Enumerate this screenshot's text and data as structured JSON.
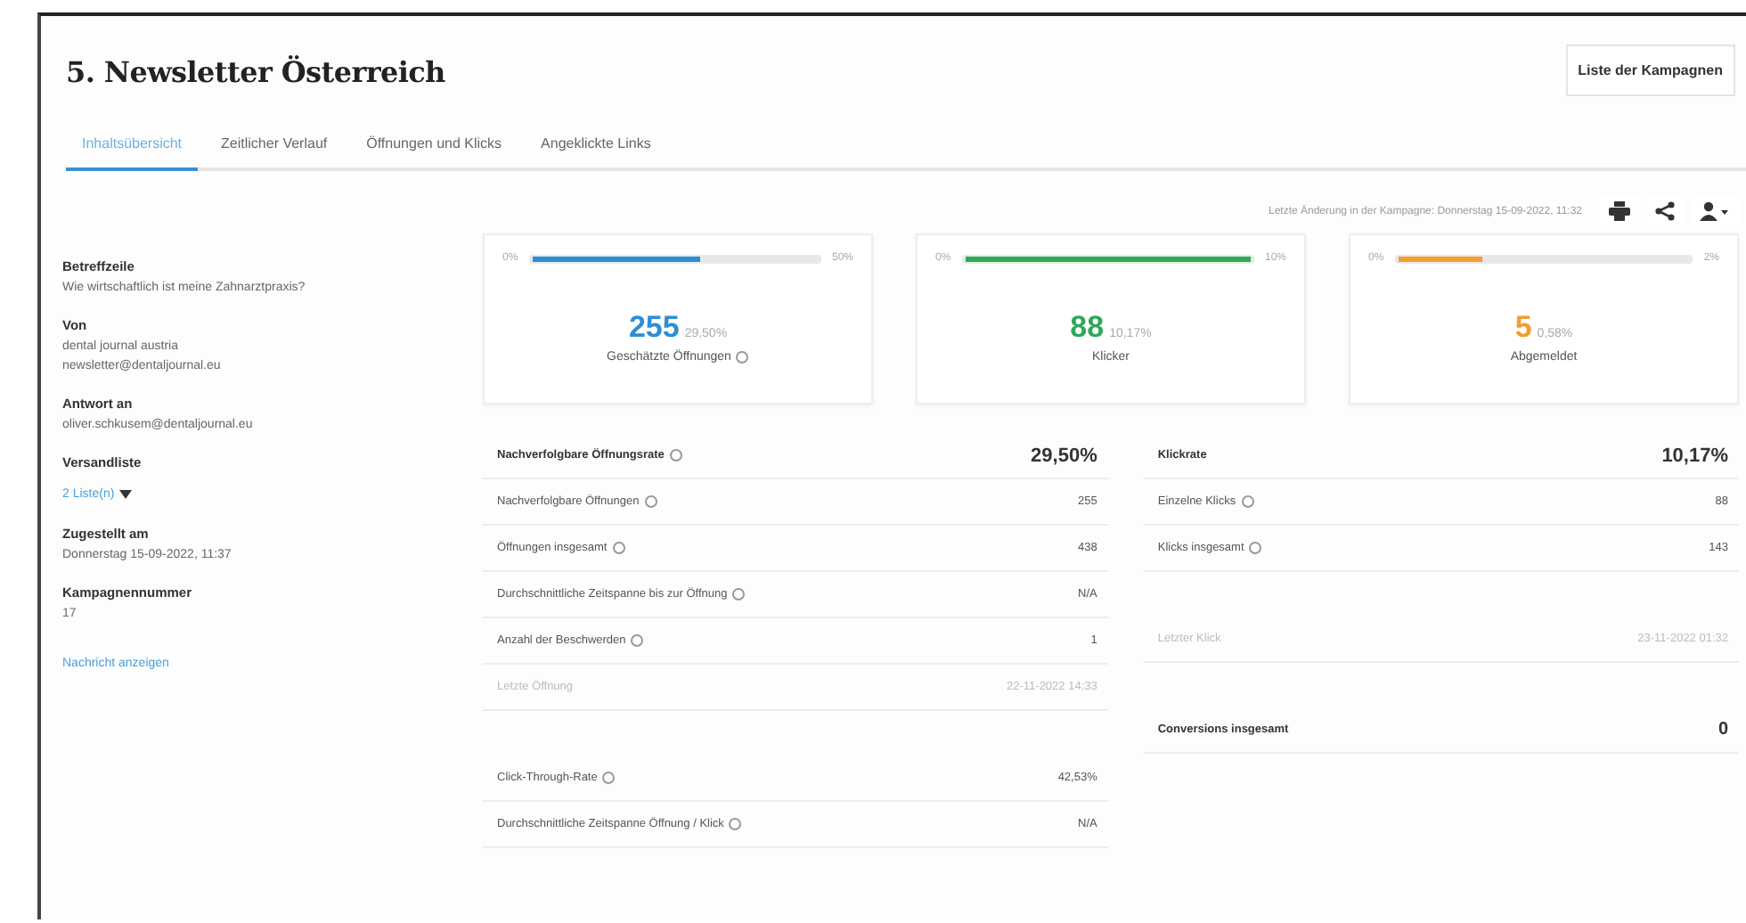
{
  "title": "5. Newsletter Österreich",
  "campaign_list_button": "Liste der Kampagnen",
  "tabs": [
    {
      "label": "Inhaltsübersicht",
      "selected": true
    },
    {
      "label": "Zeitlicher Verlauf",
      "selected": false
    },
    {
      "label": "Öffnungen und Klicks",
      "selected": false
    },
    {
      "label": "Angeklickte Links",
      "selected": false
    }
  ],
  "last_change": "Letzte Änderung in der Kampagne: Donnerstag 15-09-2022, 11:32",
  "details": [
    {
      "label": "Betreffzeile",
      "lines": [
        "Wie wirtschaftlich ist meine Zahnarztpraxis?"
      ]
    },
    {
      "label": "Von",
      "lines": [
        "dental journal austria",
        "newsletter@dentaljournal.eu"
      ]
    },
    {
      "label": "Antwort an",
      "lines": [
        "oliver.schkusem@dentaljournal.eu"
      ]
    },
    {
      "label": "Versandliste",
      "link": "2 Liste(n)"
    },
    {
      "label": "Zugestellt am",
      "lines": [
        "Donnerstag 15-09-2022, 11:37"
      ]
    },
    {
      "label": "Kampagnennummer",
      "lines": [
        "17"
      ]
    }
  ],
  "view_message_link": "Nachricht anzeigen",
  "metrics": [
    {
      "min": "0%",
      "max": "50%",
      "level": 0.59,
      "color": "#2b8fd4",
      "count": "255",
      "percent": "29,50%",
      "label": "Geschätzte Öffnungen",
      "info": true
    },
    {
      "min": "0%",
      "max": "10%",
      "level": 1,
      "color": "#2ea85a",
      "count": "88",
      "percent": "10,17%",
      "label": "Klicker",
      "info": false
    },
    {
      "min": "0%",
      "max": "2%",
      "level": 0.29,
      "color": "#f0a030",
      "count": "5",
      "percent": "0,58%",
      "label": "Abgemeldet",
      "info": false
    }
  ],
  "tables": [
    {
      "rows": [
        {
          "kind": "header",
          "label": "Nachverfolgbare Öffnungsrate",
          "value": "29,50%",
          "info": true
        },
        {
          "kind": "row",
          "label": "Nachverfolgbare Öffnungen",
          "value": "255",
          "info": true
        },
        {
          "kind": "row",
          "label": "Öffnungen insgesamt",
          "value": "438",
          "info": true
        },
        {
          "kind": "row",
          "label": "Durchschnittliche Zeitspanne bis zur Öffnung",
          "value": "N/A",
          "info": true
        },
        {
          "kind": "row",
          "label": "Anzahl der Beschwerden",
          "value": "1",
          "info": true
        },
        {
          "kind": "muted",
          "label": "Letzte Öffnung",
          "value": "22-11-2022 14:33",
          "info": false
        },
        {
          "kind": "gap"
        },
        {
          "kind": "row",
          "label": "Click-Through-Rate",
          "value": "42,53%",
          "info": true
        },
        {
          "kind": "row",
          "label": "Durchschnittliche Zeitspanne Öffnung / Klick",
          "value": "N/A",
          "info": true
        }
      ]
    },
    {
      "rows": [
        {
          "kind": "header",
          "label": "Klickrate",
          "value": "10,17%",
          "info": false
        },
        {
          "kind": "row",
          "label": "Einzelne Klicks",
          "value": "88",
          "info": true
        },
        {
          "kind": "row",
          "label": "Klicks insgesamt",
          "value": "143",
          "info": true
        },
        {
          "kind": "gap"
        },
        {
          "kind": "muted",
          "label": "Letzter Klick",
          "value": "23-11-2022 01:32",
          "info": false
        },
        {
          "kind": "gap"
        },
        {
          "kind": "total",
          "label": "Conversions insgesamt",
          "value": "0",
          "info": false
        }
      ]
    }
  ]
}
